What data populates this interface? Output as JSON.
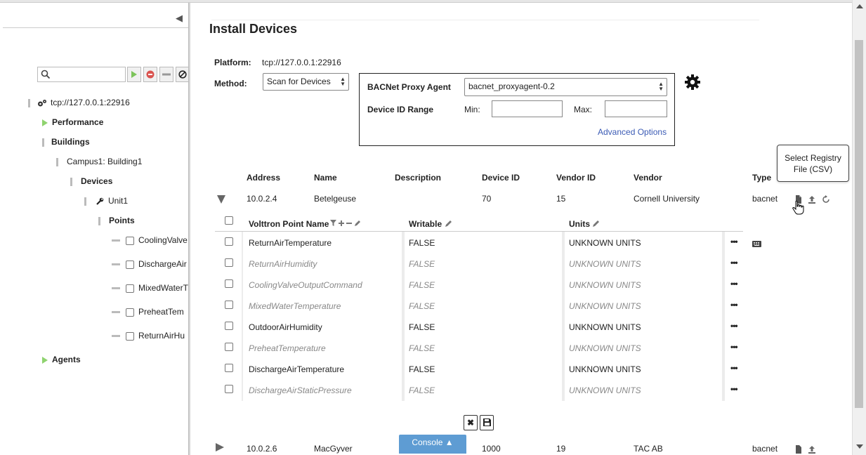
{
  "sidebar": {
    "collapse_glyph": "◀",
    "search": {
      "placeholder": "",
      "value": ""
    },
    "tree": {
      "platform": "tcp://127.0.0.1:22916",
      "performance": "Performance",
      "buildings": "Buildings",
      "campus": "Campus1: Building1",
      "devices": "Devices",
      "unit": "Unit1",
      "points": "Points",
      "point_items": [
        "CoolingValve",
        "DischargeAir",
        "MixedWaterT",
        "PreheatTem",
        "ReturnAirHu"
      ],
      "agents": "Agents"
    }
  },
  "main": {
    "title": "Install Devices",
    "platform_label": "Platform:",
    "platform_value": "tcp://127.0.0.1:22916",
    "method_label": "Method:",
    "method_value": "Scan for Devices",
    "proxy_label": "BACNet Proxy Agent",
    "proxy_value": "bacnet_proxyagent-0.2",
    "device_range_label": "Device ID Range",
    "min_label": "Min:",
    "max_label": "Max:",
    "advanced_options": "Advanced Options"
  },
  "device_table": {
    "headers": [
      "Address",
      "Name",
      "Description",
      "Device ID",
      "Vendor ID",
      "Vendor",
      "Type"
    ],
    "rows": [
      {
        "address": "10.0.2.4",
        "name": "Betelgeuse",
        "description": "",
        "device_id": "70",
        "vendor_id": "15",
        "vendor": "Cornell University",
        "type": "bacnet"
      },
      {
        "address": "10.0.2.6",
        "name": "MacGyver",
        "description": "",
        "device_id": "1000",
        "vendor_id": "19",
        "vendor": "TAC AB",
        "type": "bacnet"
      }
    ]
  },
  "points_table": {
    "headers": {
      "name": "Volttron Point Name",
      "writable": "Writable",
      "units": "Units"
    },
    "rows": [
      {
        "name": "ReturnAirTemperature",
        "writable": "FALSE",
        "units": "UNKNOWN UNITS",
        "style": "normal"
      },
      {
        "name": "ReturnAirHumidity",
        "writable": "FALSE",
        "units": "UNKNOWN UNITS",
        "style": "italic"
      },
      {
        "name": "CoolingValveOutputCommand",
        "writable": "FALSE",
        "units": "UNKNOWN UNITS",
        "style": "italic"
      },
      {
        "name": "MixedWaterTemperature",
        "writable": "FALSE",
        "units": "UNKNOWN UNITS",
        "style": "italic"
      },
      {
        "name": "OutdoorAirHumidity",
        "writable": "FALSE",
        "units": "UNKNOWN UNITS",
        "style": "normal"
      },
      {
        "name": "PreheatTemperature",
        "writable": "FALSE",
        "units": "UNKNOWN UNITS",
        "style": "italic"
      },
      {
        "name": "DischargeAirTemperature",
        "writable": "FALSE",
        "units": "UNKNOWN UNITS",
        "style": "normal"
      },
      {
        "name": "DischargeAirStaticPressure",
        "writable": "FALSE",
        "units": "UNKNOWN UNITS",
        "style": "italic"
      }
    ],
    "more_glyph": "•••"
  },
  "tooltip": {
    "line1": "Select Registry",
    "line2": "File (CSV)"
  },
  "console": {
    "label": "Console ▲"
  },
  "buttons": {
    "cancel": "✖"
  },
  "colors": {
    "accent": "#5e9cd3",
    "link": "#3b5bb5",
    "tree_arrow": "#8fd36f"
  }
}
